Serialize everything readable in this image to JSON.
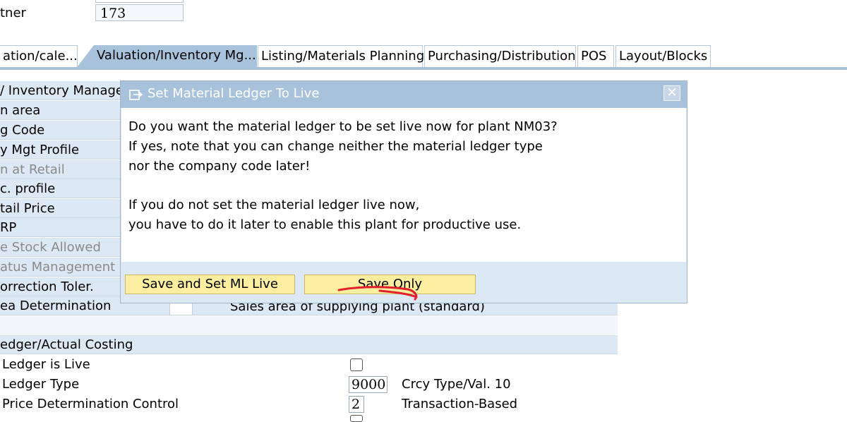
{
  "top": {
    "label": "tner",
    "value": "173"
  },
  "tabs": [
    {
      "label": "ation/cale..."
    },
    {
      "label": "Valuation/Inventory Mg..."
    },
    {
      "label": "Listing/Materials Planning"
    },
    {
      "label": "Purchasing/Distribution"
    },
    {
      "label": "POS"
    },
    {
      "label": "Layout/Blocks"
    }
  ],
  "form": {
    "section1_title": "/ Inventory Manage",
    "rows": [
      "n area",
      "g Code",
      "y Mgt Profile",
      "n at Retail",
      "c. profile",
      "tail Price",
      "RP",
      "e Stock Allowed",
      "atus Management",
      "orrection Toler.",
      "ea Determination"
    ],
    "sales_area_text": "Sales area of supplying plant (standard)",
    "section2_title": "edger/Actual Costing",
    "section2_rows": [
      {
        "label": "Ledger is Live"
      },
      {
        "label": "Ledger Type",
        "value": "9000",
        "desc": "Crcy Type/Val. 10"
      },
      {
        "label": "Price Determination Control",
        "value": "2",
        "desc": "Transaction-Based"
      }
    ]
  },
  "dialog": {
    "title": "Set Material Ledger To Live",
    "close_glyph": "✕",
    "messages": [
      "Do you want the material ledger to be set live now for plant NM03?",
      "If yes, note that you can change neither the material ledger type",
      "nor the company code later!",
      "If you do not set the material ledger live now,",
      "you have to do it later to enable this plant for productive use."
    ],
    "buttons": {
      "save_and_set_live": "Save and Set ML Live",
      "save_only": "Save Only"
    }
  },
  "colors": {
    "tab_active": "#a9c2dc",
    "panel": "#dce8f4",
    "button": "#fbeea0",
    "annotation": "#e0202a"
  }
}
